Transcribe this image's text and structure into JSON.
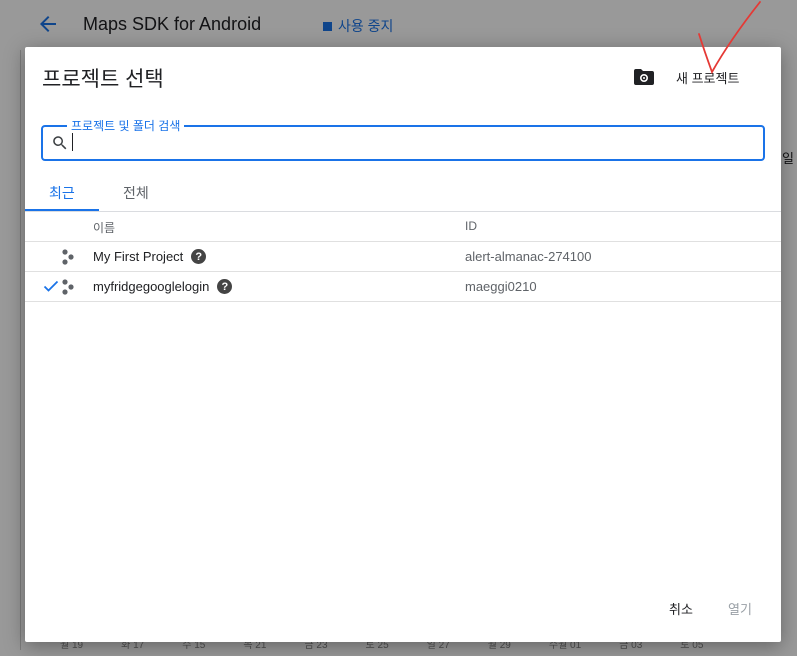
{
  "background": {
    "title": "Maps SDK for Android",
    "disable_label": "사용 중지",
    "side_text": "일",
    "axis_labels": [
      "월 19",
      "화 17",
      "수 15",
      "목 21",
      "금 23",
      "토 25",
      "일 27",
      "월 29",
      "수월 01",
      "금 03",
      "토 05"
    ]
  },
  "dialog": {
    "title": "프로젝트 선택",
    "new_project_label": "새 프로젝트",
    "search": {
      "label": "프로젝트 및 폴더 검색",
      "value": ""
    },
    "tabs": [
      {
        "label": "최근",
        "active": true
      },
      {
        "label": "전체",
        "active": false
      }
    ],
    "table": {
      "columns": {
        "name": "이름",
        "id": "ID"
      },
      "rows": [
        {
          "name": "My First Project",
          "id": "alert-almanac-274100",
          "selected": false
        },
        {
          "name": "myfridgegooglelogin",
          "id": "maeggi0210",
          "selected": true
        }
      ]
    },
    "buttons": {
      "cancel": "취소",
      "open": "열기"
    }
  },
  "colors": {
    "accent": "#1a73e8",
    "annotation": "#e53935"
  }
}
